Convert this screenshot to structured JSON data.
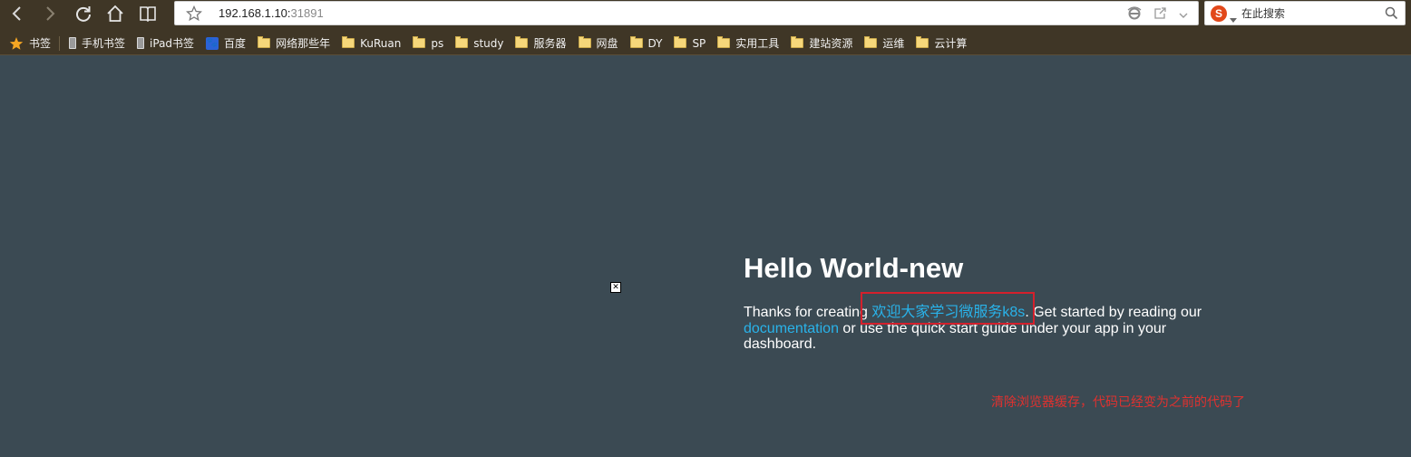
{
  "address_bar": {
    "host": "192.168.1.10:",
    "port": "31891"
  },
  "search": {
    "placeholder": "在此搜索",
    "engine_letter": "S"
  },
  "bookmarks": [
    {
      "label": "书签",
      "icon": "star-icon"
    },
    {
      "label": "手机书签",
      "icon": "phone-icon"
    },
    {
      "label": "iPad书签",
      "icon": "tablet-icon"
    },
    {
      "label": "百度",
      "icon": "baidu-icon"
    },
    {
      "label": "网络那些年",
      "icon": "folder-icon"
    },
    {
      "label": "KuRuan",
      "icon": "folder-icon"
    },
    {
      "label": "ps",
      "icon": "folder-icon"
    },
    {
      "label": "study",
      "icon": "folder-icon"
    },
    {
      "label": "服务器",
      "icon": "folder-icon"
    },
    {
      "label": "网盘",
      "icon": "folder-icon"
    },
    {
      "label": "DY",
      "icon": "folder-icon"
    },
    {
      "label": "SP",
      "icon": "folder-icon"
    },
    {
      "label": "实用工具",
      "icon": "folder-icon"
    },
    {
      "label": "建站资源",
      "icon": "folder-icon"
    },
    {
      "label": "运维",
      "icon": "folder-icon"
    },
    {
      "label": "云计算",
      "icon": "folder-icon"
    }
  ],
  "page": {
    "heading": "Hello World-new",
    "text_before_link": "Thanks for creating ",
    "app_link": "欢迎大家学习微服务k8s",
    "text_after_link": ". Get started by reading our ",
    "docs_link": "documentation",
    "text_end": " or use the quick start guide under your app in your dashboard."
  },
  "annotation": "清除浏览器缓存，代码已经变为之前的代码了",
  "colors": {
    "background": "#3b4a53",
    "toolbar": "#3f3626",
    "link": "#29b3ea",
    "annotation": "#e0312f"
  }
}
